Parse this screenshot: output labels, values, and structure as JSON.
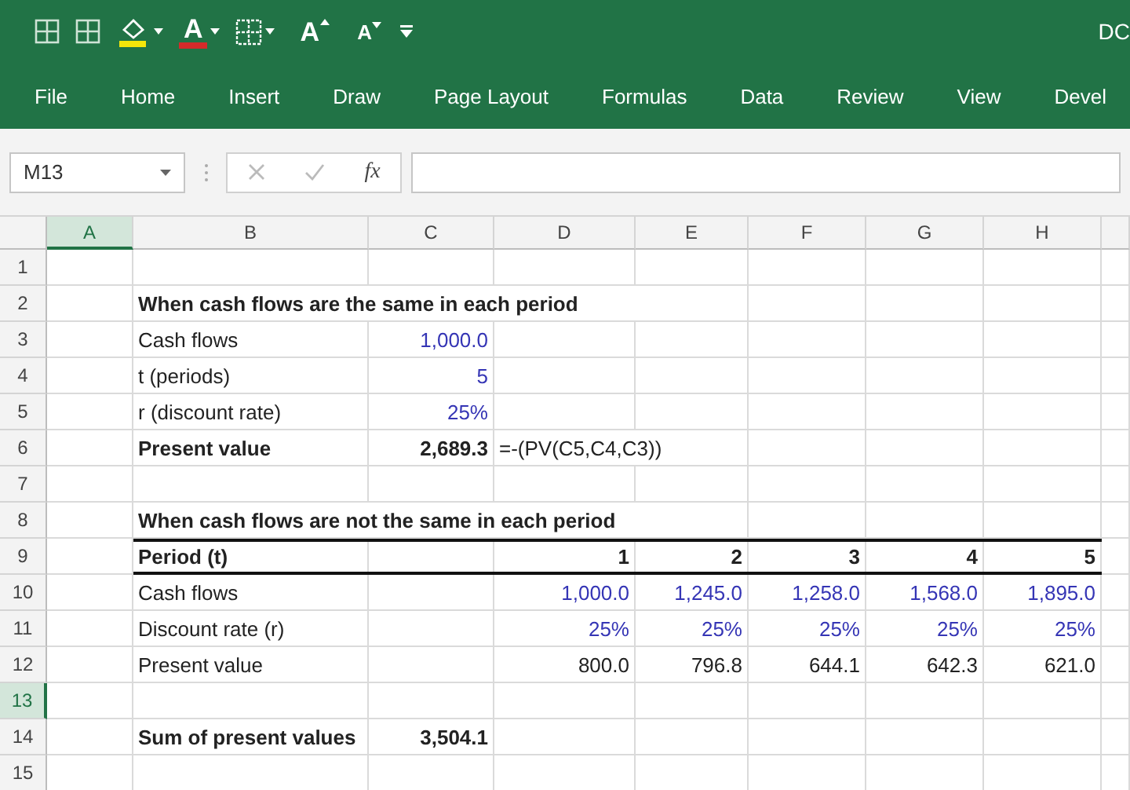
{
  "window": {
    "title": "DC"
  },
  "quick_access": [
    {
      "kind": "grid"
    },
    {
      "kind": "grid"
    },
    {
      "kind": "fill"
    },
    {
      "kind": "font-color",
      "glyph": "A"
    },
    {
      "kind": "borders"
    },
    {
      "kind": "grow",
      "glyph": "A"
    },
    {
      "kind": "shrink",
      "glyph": "A"
    },
    {
      "kind": "customize"
    }
  ],
  "ribbon_tabs": [
    {
      "label": "File",
      "selected": false
    },
    {
      "label": "Home",
      "selected": false
    },
    {
      "label": "Insert",
      "selected": false
    },
    {
      "label": "Draw",
      "selected": false
    },
    {
      "label": "Page Layout",
      "selected": false
    },
    {
      "label": "Formulas",
      "selected": false
    },
    {
      "label": "Data",
      "selected": false
    },
    {
      "label": "Review",
      "selected": false
    },
    {
      "label": "View",
      "selected": false
    },
    {
      "label": "Devel",
      "selected": false
    }
  ],
  "formula_bar": {
    "name_box": "M13",
    "function_label": "fx"
  },
  "columns": [
    {
      "label": "A",
      "selected": true
    },
    {
      "label": "B",
      "selected": false
    },
    {
      "label": "C",
      "selected": false
    },
    {
      "label": "D",
      "selected": false
    },
    {
      "label": "E",
      "selected": false
    },
    {
      "label": "F",
      "selected": false
    },
    {
      "label": "G",
      "selected": false
    },
    {
      "label": "H",
      "selected": false
    }
  ],
  "rows": [
    {
      "number": "1",
      "selected": false,
      "cells": [
        {
          "kind": "blank"
        },
        {
          "kind": "blank"
        },
        {
          "kind": "blank"
        },
        {
          "kind": "blank"
        },
        {
          "kind": "blank"
        },
        {
          "kind": "blank"
        },
        {
          "kind": "blank"
        },
        {
          "kind": "blank"
        }
      ]
    },
    {
      "number": "2",
      "selected": false,
      "cells": [
        {
          "kind": "blank"
        },
        {
          "text": "When cash flows are the same in each period",
          "kind": "heading"
        },
        {
          "kind": "blank"
        },
        {
          "kind": "blank"
        },
        {
          "kind": "blank"
        },
        {
          "kind": "blank"
        },
        {
          "kind": "blank"
        },
        {
          "kind": "blank"
        }
      ]
    },
    {
      "number": "3",
      "selected": false,
      "cells": [
        {
          "kind": "blank"
        },
        {
          "text": "Cash flows",
          "kind": "label"
        },
        {
          "text": "1,000.0",
          "kind": "input"
        },
        {
          "kind": "blank"
        },
        {
          "kind": "blank"
        },
        {
          "kind": "blank"
        },
        {
          "kind": "blank"
        },
        {
          "kind": "blank"
        }
      ]
    },
    {
      "number": "4",
      "selected": false,
      "cells": [
        {
          "kind": "blank"
        },
        {
          "text": "t (periods)",
          "kind": "label"
        },
        {
          "text": "5",
          "kind": "input"
        },
        {
          "kind": "blank"
        },
        {
          "kind": "blank"
        },
        {
          "kind": "blank"
        },
        {
          "kind": "blank"
        },
        {
          "kind": "blank"
        }
      ]
    },
    {
      "number": "5",
      "selected": false,
      "cells": [
        {
          "kind": "blank"
        },
        {
          "text": "r (discount rate)",
          "kind": "label"
        },
        {
          "text": "25%",
          "kind": "input"
        },
        {
          "kind": "blank"
        },
        {
          "kind": "blank"
        },
        {
          "kind": "blank"
        },
        {
          "kind": "blank"
        },
        {
          "kind": "blank"
        }
      ]
    },
    {
      "number": "6",
      "selected": false,
      "cells": [
        {
          "kind": "blank"
        },
        {
          "text": "Present value",
          "kind": "heading"
        },
        {
          "text": "2,689.3",
          "kind": "total"
        },
        {
          "text": "=-(PV(C5,C4,C3))",
          "kind": "label"
        },
        {
          "kind": "blank"
        },
        {
          "kind": "blank"
        },
        {
          "kind": "blank"
        },
        {
          "kind": "blank"
        }
      ]
    },
    {
      "number": "7",
      "selected": false,
      "cells": [
        {
          "kind": "blank"
        },
        {
          "kind": "blank"
        },
        {
          "kind": "blank"
        },
        {
          "kind": "blank"
        },
        {
          "kind": "blank"
        },
        {
          "kind": "blank"
        },
        {
          "kind": "blank"
        },
        {
          "kind": "blank"
        }
      ]
    },
    {
      "number": "8",
      "selected": false,
      "cells": [
        {
          "kind": "blank"
        },
        {
          "text": "When cash flows are not the same in each period",
          "kind": "heading"
        },
        {
          "kind": "blank"
        },
        {
          "kind": "blank"
        },
        {
          "kind": "blank"
        },
        {
          "kind": "blank"
        },
        {
          "kind": "blank"
        },
        {
          "kind": "blank"
        }
      ]
    },
    {
      "number": "9",
      "selected": false,
      "header_rule": true,
      "cells": [
        {
          "kind": "blank"
        },
        {
          "text": "Period (t)",
          "kind": "heading"
        },
        {
          "kind": "blank"
        },
        {
          "text": "1",
          "kind": "total"
        },
        {
          "text": "2",
          "kind": "total"
        },
        {
          "text": "3",
          "kind": "total"
        },
        {
          "text": "4",
          "kind": "total"
        },
        {
          "text": "5",
          "kind": "total"
        }
      ]
    },
    {
      "number": "10",
      "selected": false,
      "cells": [
        {
          "kind": "blank"
        },
        {
          "text": "Cash flows",
          "kind": "label"
        },
        {
          "kind": "blank"
        },
        {
          "text": "1,000.0",
          "kind": "input"
        },
        {
          "text": "1,245.0",
          "kind": "input"
        },
        {
          "text": "1,258.0",
          "kind": "input"
        },
        {
          "text": "1,568.0",
          "kind": "input"
        },
        {
          "text": "1,895.0",
          "kind": "input"
        }
      ]
    },
    {
      "number": "11",
      "selected": false,
      "cells": [
        {
          "kind": "blank"
        },
        {
          "text": "Discount rate (r)",
          "kind": "label"
        },
        {
          "kind": "blank"
        },
        {
          "text": "25%",
          "kind": "input"
        },
        {
          "text": "25%",
          "kind": "input"
        },
        {
          "text": "25%",
          "kind": "input"
        },
        {
          "text": "25%",
          "kind": "input"
        },
        {
          "text": "25%",
          "kind": "input"
        }
      ]
    },
    {
      "number": "12",
      "selected": false,
      "cells": [
        {
          "kind": "blank"
        },
        {
          "text": "Present value",
          "kind": "label"
        },
        {
          "kind": "blank"
        },
        {
          "text": "800.0",
          "kind": "number"
        },
        {
          "text": "796.8",
          "kind": "number"
        },
        {
          "text": "644.1",
          "kind": "number"
        },
        {
          "text": "642.3",
          "kind": "number"
        },
        {
          "text": "621.0",
          "kind": "number"
        }
      ]
    },
    {
      "number": "13",
      "selected": true,
      "cells": [
        {
          "kind": "blank"
        },
        {
          "kind": "blank"
        },
        {
          "kind": "blank"
        },
        {
          "kind": "blank"
        },
        {
          "kind": "blank"
        },
        {
          "kind": "blank"
        },
        {
          "kind": "blank"
        },
        {
          "kind": "blank"
        }
      ]
    },
    {
      "number": "14",
      "selected": false,
      "cells": [
        {
          "kind": "blank"
        },
        {
          "text": "Sum of present values",
          "kind": "heading"
        },
        {
          "text": "3,504.1",
          "kind": "total"
        },
        {
          "kind": "blank"
        },
        {
          "kind": "blank"
        },
        {
          "kind": "blank"
        },
        {
          "kind": "blank"
        },
        {
          "kind": "blank"
        }
      ]
    },
    {
      "number": "15",
      "selected": false,
      "cells": [
        {
          "kind": "blank"
        },
        {
          "kind": "blank"
        },
        {
          "kind": "blank"
        },
        {
          "kind": "blank"
        },
        {
          "kind": "blank"
        },
        {
          "kind": "blank"
        },
        {
          "kind": "blank"
        },
        {
          "kind": "blank"
        }
      ]
    }
  ]
}
